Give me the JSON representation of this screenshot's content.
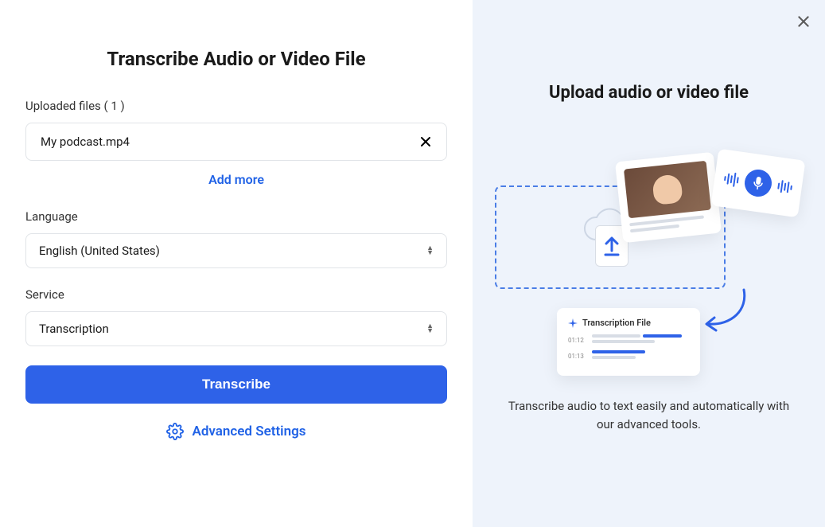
{
  "left": {
    "heading": "Transcribe Audio or Video File",
    "uploaded_label": "Uploaded files ( 1 )",
    "file_name": "My podcast.mp4",
    "add_more": "Add more",
    "language_label": "Language",
    "language_value": "English (United States)",
    "service_label": "Service",
    "service_value": "Transcription",
    "transcribe_btn": "Transcribe",
    "advanced": "Advanced Settings"
  },
  "right": {
    "title": "Upload audio or video file",
    "desc": "Transcribe audio to text easily and automatically with our advanced tools.",
    "transcript_card_title": "Transcription File",
    "time1": "01:12",
    "time2": "01:13"
  },
  "colors": {
    "primary": "#2e62e8",
    "link": "#2062e6"
  }
}
